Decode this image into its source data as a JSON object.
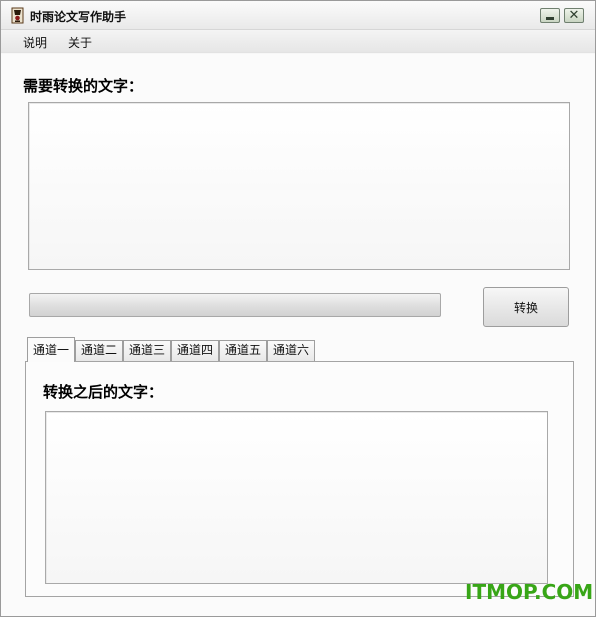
{
  "window": {
    "title": "时雨论文写作助手",
    "minimize_icon": "minimize-icon",
    "close_icon": "close-icon",
    "close_glyph": "✕"
  },
  "menu": {
    "items": [
      {
        "label": "说明"
      },
      {
        "label": "关于"
      }
    ]
  },
  "input": {
    "label": "需要转换的文字：",
    "value": ""
  },
  "progress": {
    "value": 0
  },
  "convert_button": {
    "label": "转换"
  },
  "tabs": [
    {
      "label": "通道一",
      "active": true
    },
    {
      "label": "通道二",
      "active": false
    },
    {
      "label": "通道三",
      "active": false
    },
    {
      "label": "通道四",
      "active": false
    },
    {
      "label": "通道五",
      "active": false
    },
    {
      "label": "通道六",
      "active": false
    }
  ],
  "output": {
    "label": "转换之后的文字：",
    "value": ""
  },
  "watermark": {
    "text": "ITMOP.COM",
    "color": "#38a617"
  },
  "colors": {
    "window_bg": "#f7f7f7",
    "content_bg": "#fbfbfb",
    "border": "#a9a9a9"
  }
}
